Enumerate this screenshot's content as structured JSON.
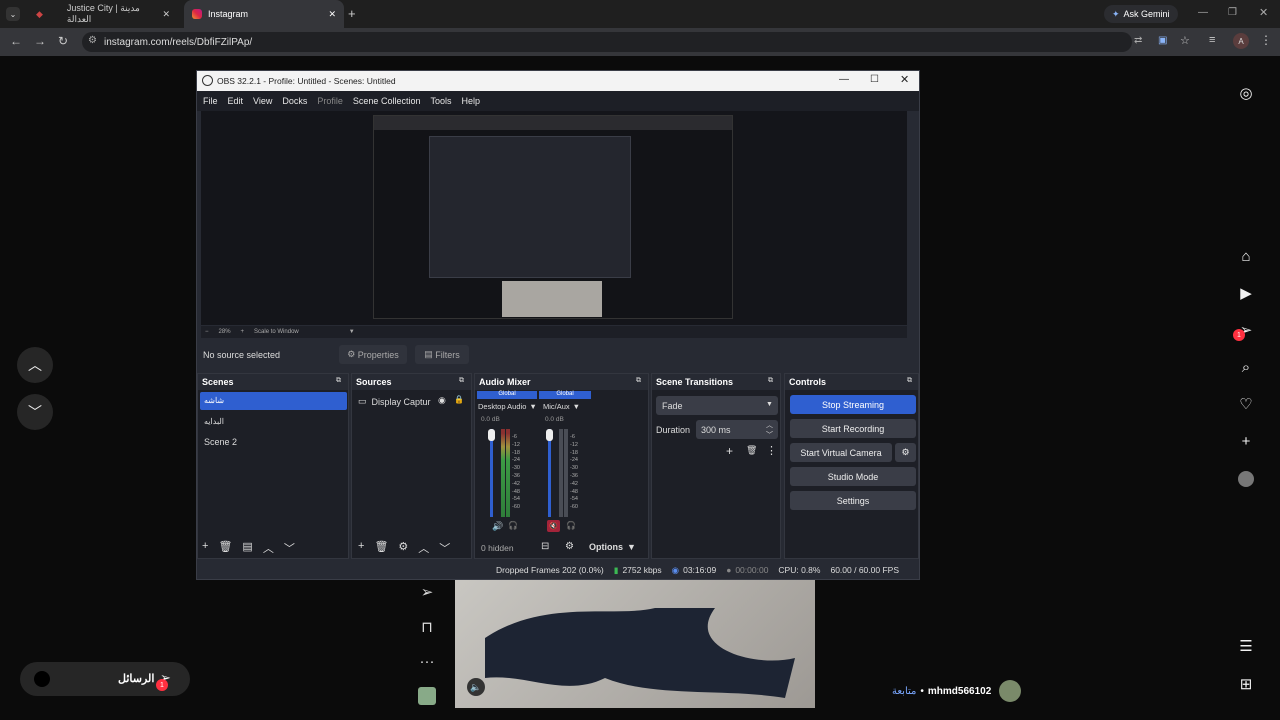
{
  "browser": {
    "tabs": [
      {
        "label": "Justice City | مدينة العدالة"
      },
      {
        "label": "Instagram"
      }
    ],
    "ask_gemini": "Ask Gemini",
    "url": "instagram.com/reels/DbfiFZilPAp/",
    "profile_initial": "A"
  },
  "obs": {
    "title": "OBS 32.2.1 - Profile: Untitled - Scenes: Untitled",
    "menu": [
      "File",
      "Edit",
      "View",
      "Docks",
      "Profile",
      "Scene Collection",
      "Tools",
      "Help"
    ],
    "zoom": "28%",
    "scale_mode": "Scale to Window",
    "no_source": "No source selected",
    "properties": "Properties",
    "filters": "Filters",
    "scenes": {
      "title": "Scenes",
      "items": [
        "شاشه",
        "البدايه",
        "Scene 2"
      ]
    },
    "sources": {
      "title": "Sources",
      "items": [
        "Display Captur"
      ]
    },
    "mixer": {
      "title": "Audio Mixer",
      "channels": [
        {
          "scope": "Global",
          "name": "Desktop Audio",
          "db": "0.0 dB"
        },
        {
          "scope": "Global",
          "name": "Mic/Aux",
          "db": "0.0 dB"
        }
      ],
      "ticks": [
        "-6",
        "-12",
        "-18",
        "-24",
        "-30",
        "-36",
        "-42",
        "-48",
        "-54",
        "-60"
      ],
      "hidden": "0 hidden",
      "options": "Options"
    },
    "transitions": {
      "title": "Scene Transitions",
      "selected": "Fade",
      "duration_label": "Duration",
      "duration": "300 ms"
    },
    "controls": {
      "title": "Controls",
      "stop_streaming": "Stop Streaming",
      "start_recording": "Start Recording",
      "start_virtual_camera": "Start Virtual Camera",
      "studio_mode": "Studio Mode",
      "settings": "Settings"
    },
    "status": {
      "dropped": "Dropped Frames 202 (0.0%)",
      "kbps": "2752 kbps",
      "stream_time": "03:16:09",
      "rec_time": "00:00:00",
      "cpu": "CPU: 0.8%",
      "fps": "60.00 / 60.00 FPS"
    }
  },
  "instagram": {
    "messages_label": "الرسائل",
    "messages_badge": "1",
    "notif_badge": "1",
    "username": "mhmd566102",
    "follow": "متابعة"
  },
  "colors": {
    "accent": "#2f5fd0",
    "badge": "#ff3040"
  }
}
